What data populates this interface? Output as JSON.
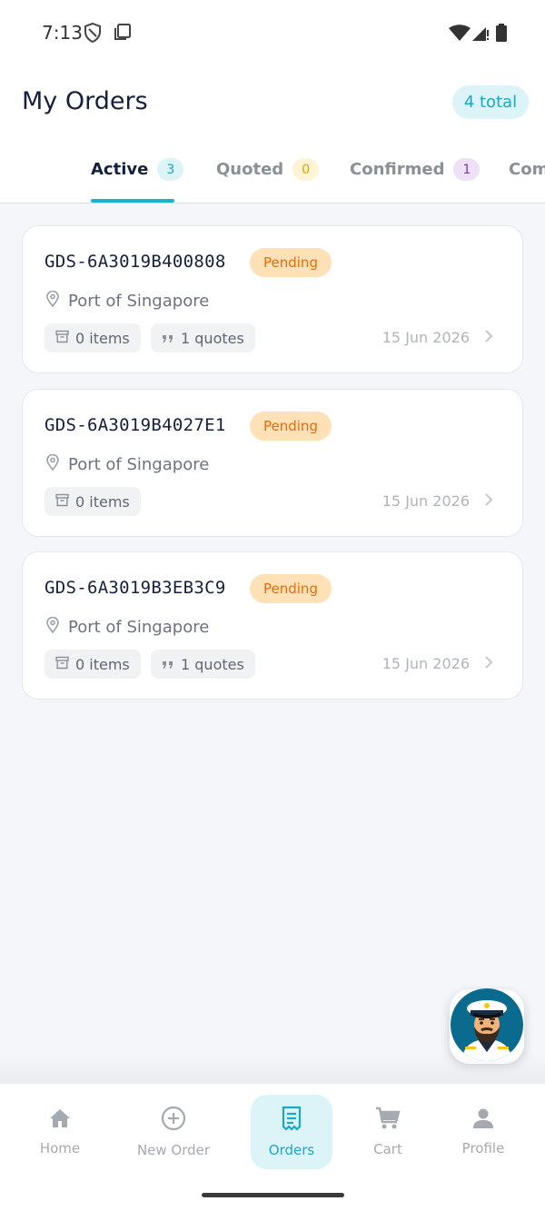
{
  "status_bar": {
    "time": "7:13"
  },
  "header": {
    "title": "My Orders",
    "total_label": "4 total"
  },
  "tabs": [
    {
      "label": "Active",
      "count": "3",
      "active": true
    },
    {
      "label": "Quoted",
      "count": "0",
      "active": false
    },
    {
      "label": "Confirmed",
      "count": "1",
      "active": false
    },
    {
      "label": "Com",
      "count": "",
      "active": false
    }
  ],
  "orders": [
    {
      "id": "GDS-6A3019B400808",
      "status": "Pending",
      "port": "Port of Singapore",
      "items": "0 items",
      "quotes": "1 quotes",
      "date": "15 Jun 2026"
    },
    {
      "id": "GDS-6A3019B4027E1",
      "status": "Pending",
      "port": "Port of Singapore",
      "items": "0 items",
      "quotes": "",
      "date": "15 Jun 2026"
    },
    {
      "id": "GDS-6A3019B3EB3C9",
      "status": "Pending",
      "port": "Port of Singapore",
      "items": "0 items",
      "quotes": "1 quotes",
      "date": "15 Jun 2026"
    }
  ],
  "fab": {
    "icon": "captain-avatar-icon"
  },
  "bottom_nav": [
    {
      "label": "Home",
      "icon": "home-icon"
    },
    {
      "label": "New Order",
      "icon": "plus-circle-icon"
    },
    {
      "label": "Orders",
      "icon": "receipt-icon",
      "active": true
    },
    {
      "label": "Cart",
      "icon": "cart-icon"
    },
    {
      "label": "Profile",
      "icon": "person-icon"
    }
  ],
  "colors": {
    "accent": "#19b3cf",
    "pending_bg": "#ffe1b8",
    "pending_text": "#e86b0a",
    "quoted_badge_bg": "#fff4d6",
    "confirmed_badge_bg": "#ede0f7"
  }
}
